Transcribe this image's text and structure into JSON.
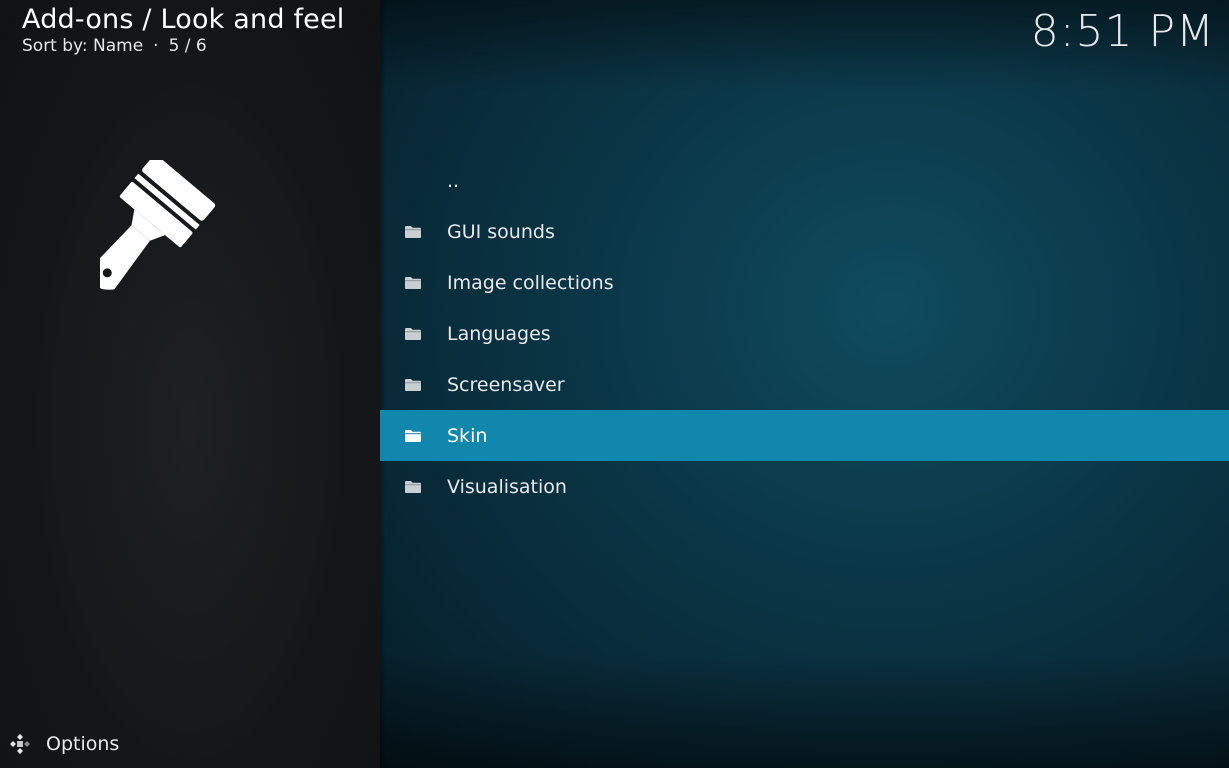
{
  "header": {
    "breadcrumb": "Add-ons / Look and feel",
    "sort_label": "Sort by: Name",
    "separator": "·",
    "position": "5 / 6",
    "clock": "8:51 PM"
  },
  "list": {
    "items": [
      {
        "label": "..",
        "icon": "none"
      },
      {
        "label": "GUI sounds",
        "icon": "folder-icon"
      },
      {
        "label": "Image collections",
        "icon": "folder-icon"
      },
      {
        "label": "Languages",
        "icon": "folder-icon"
      },
      {
        "label": "Screensaver",
        "icon": "folder-icon"
      },
      {
        "label": "Skin",
        "icon": "folder-icon",
        "selected": true
      },
      {
        "label": "Visualisation",
        "icon": "folder-icon"
      }
    ]
  },
  "footer": {
    "options_label": "Options"
  },
  "colors": {
    "selected_bg": "#1287ad",
    "panel_right": "#0a3545",
    "panel_left": "#141618"
  }
}
